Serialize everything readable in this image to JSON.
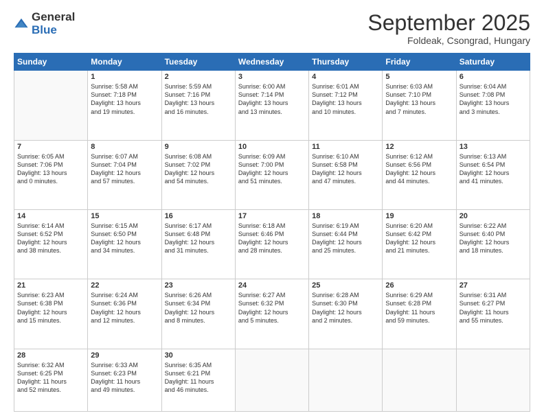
{
  "header": {
    "logo": {
      "general": "General",
      "blue": "Blue"
    },
    "title": "September 2025",
    "subtitle": "Foldeak, Csongrad, Hungary"
  },
  "days_of_week": [
    "Sunday",
    "Monday",
    "Tuesday",
    "Wednesday",
    "Thursday",
    "Friday",
    "Saturday"
  ],
  "weeks": [
    [
      {
        "day": "",
        "content": ""
      },
      {
        "day": "1",
        "content": "Sunrise: 5:58 AM\nSunset: 7:18 PM\nDaylight: 13 hours\nand 19 minutes."
      },
      {
        "day": "2",
        "content": "Sunrise: 5:59 AM\nSunset: 7:16 PM\nDaylight: 13 hours\nand 16 minutes."
      },
      {
        "day": "3",
        "content": "Sunrise: 6:00 AM\nSunset: 7:14 PM\nDaylight: 13 hours\nand 13 minutes."
      },
      {
        "day": "4",
        "content": "Sunrise: 6:01 AM\nSunset: 7:12 PM\nDaylight: 13 hours\nand 10 minutes."
      },
      {
        "day": "5",
        "content": "Sunrise: 6:03 AM\nSunset: 7:10 PM\nDaylight: 13 hours\nand 7 minutes."
      },
      {
        "day": "6",
        "content": "Sunrise: 6:04 AM\nSunset: 7:08 PM\nDaylight: 13 hours\nand 3 minutes."
      }
    ],
    [
      {
        "day": "7",
        "content": "Sunrise: 6:05 AM\nSunset: 7:06 PM\nDaylight: 13 hours\nand 0 minutes."
      },
      {
        "day": "8",
        "content": "Sunrise: 6:07 AM\nSunset: 7:04 PM\nDaylight: 12 hours\nand 57 minutes."
      },
      {
        "day": "9",
        "content": "Sunrise: 6:08 AM\nSunset: 7:02 PM\nDaylight: 12 hours\nand 54 minutes."
      },
      {
        "day": "10",
        "content": "Sunrise: 6:09 AM\nSunset: 7:00 PM\nDaylight: 12 hours\nand 51 minutes."
      },
      {
        "day": "11",
        "content": "Sunrise: 6:10 AM\nSunset: 6:58 PM\nDaylight: 12 hours\nand 47 minutes."
      },
      {
        "day": "12",
        "content": "Sunrise: 6:12 AM\nSunset: 6:56 PM\nDaylight: 12 hours\nand 44 minutes."
      },
      {
        "day": "13",
        "content": "Sunrise: 6:13 AM\nSunset: 6:54 PM\nDaylight: 12 hours\nand 41 minutes."
      }
    ],
    [
      {
        "day": "14",
        "content": "Sunrise: 6:14 AM\nSunset: 6:52 PM\nDaylight: 12 hours\nand 38 minutes."
      },
      {
        "day": "15",
        "content": "Sunrise: 6:15 AM\nSunset: 6:50 PM\nDaylight: 12 hours\nand 34 minutes."
      },
      {
        "day": "16",
        "content": "Sunrise: 6:17 AM\nSunset: 6:48 PM\nDaylight: 12 hours\nand 31 minutes."
      },
      {
        "day": "17",
        "content": "Sunrise: 6:18 AM\nSunset: 6:46 PM\nDaylight: 12 hours\nand 28 minutes."
      },
      {
        "day": "18",
        "content": "Sunrise: 6:19 AM\nSunset: 6:44 PM\nDaylight: 12 hours\nand 25 minutes."
      },
      {
        "day": "19",
        "content": "Sunrise: 6:20 AM\nSunset: 6:42 PM\nDaylight: 12 hours\nand 21 minutes."
      },
      {
        "day": "20",
        "content": "Sunrise: 6:22 AM\nSunset: 6:40 PM\nDaylight: 12 hours\nand 18 minutes."
      }
    ],
    [
      {
        "day": "21",
        "content": "Sunrise: 6:23 AM\nSunset: 6:38 PM\nDaylight: 12 hours\nand 15 minutes."
      },
      {
        "day": "22",
        "content": "Sunrise: 6:24 AM\nSunset: 6:36 PM\nDaylight: 12 hours\nand 12 minutes."
      },
      {
        "day": "23",
        "content": "Sunrise: 6:26 AM\nSunset: 6:34 PM\nDaylight: 12 hours\nand 8 minutes."
      },
      {
        "day": "24",
        "content": "Sunrise: 6:27 AM\nSunset: 6:32 PM\nDaylight: 12 hours\nand 5 minutes."
      },
      {
        "day": "25",
        "content": "Sunrise: 6:28 AM\nSunset: 6:30 PM\nDaylight: 12 hours\nand 2 minutes."
      },
      {
        "day": "26",
        "content": "Sunrise: 6:29 AM\nSunset: 6:28 PM\nDaylight: 11 hours\nand 59 minutes."
      },
      {
        "day": "27",
        "content": "Sunrise: 6:31 AM\nSunset: 6:27 PM\nDaylight: 11 hours\nand 55 minutes."
      }
    ],
    [
      {
        "day": "28",
        "content": "Sunrise: 6:32 AM\nSunset: 6:25 PM\nDaylight: 11 hours\nand 52 minutes."
      },
      {
        "day": "29",
        "content": "Sunrise: 6:33 AM\nSunset: 6:23 PM\nDaylight: 11 hours\nand 49 minutes."
      },
      {
        "day": "30",
        "content": "Sunrise: 6:35 AM\nSunset: 6:21 PM\nDaylight: 11 hours\nand 46 minutes."
      },
      {
        "day": "",
        "content": ""
      },
      {
        "day": "",
        "content": ""
      },
      {
        "day": "",
        "content": ""
      },
      {
        "day": "",
        "content": ""
      }
    ]
  ]
}
